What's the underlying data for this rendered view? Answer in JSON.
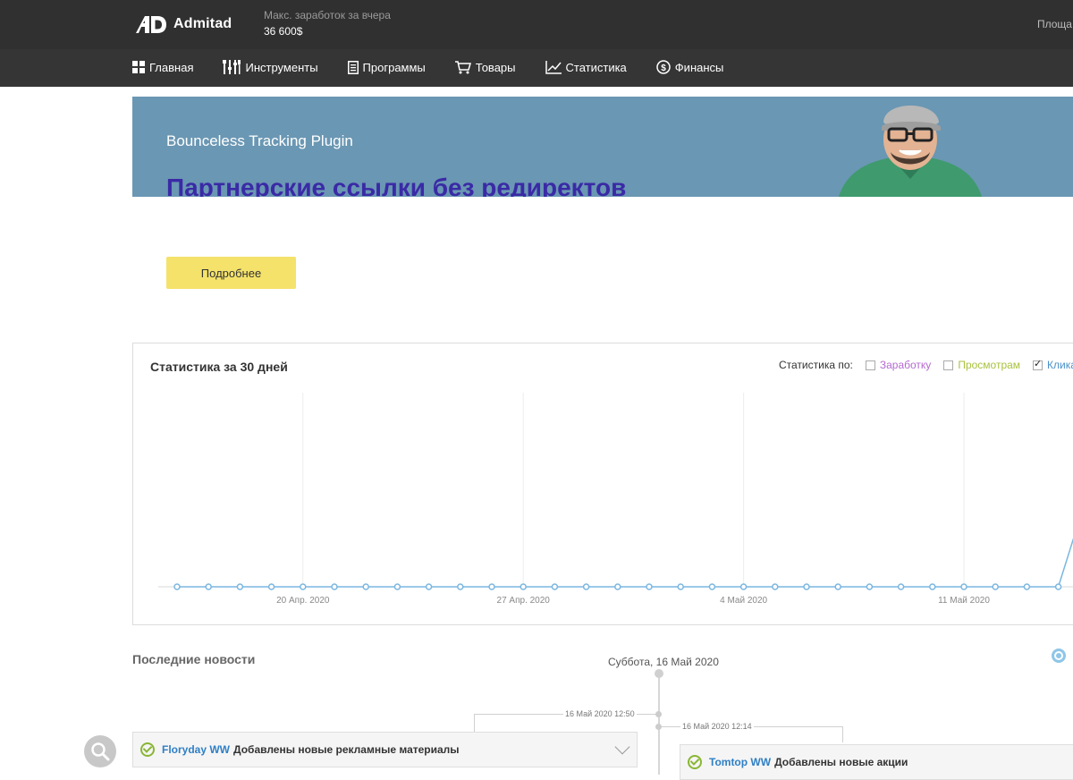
{
  "header": {
    "logo_text": "Admitad",
    "earnings_label": "Макс. заработок за вчера",
    "earnings_value": "36 600$",
    "platform_label": "Площа",
    "nav": [
      {
        "label": "Главная",
        "icon": "grid-icon"
      },
      {
        "label": "Инструменты",
        "icon": "tools-icon"
      },
      {
        "label": "Программы",
        "icon": "document-icon"
      },
      {
        "label": "Товары",
        "icon": "cart-icon"
      },
      {
        "label": "Статистика",
        "icon": "chart-icon"
      },
      {
        "label": "Финансы",
        "icon": "dollar-icon"
      }
    ]
  },
  "banner": {
    "subtitle": "Bounceless Tracking Plugin",
    "title": "Партнерские ссылки без редиректов",
    "button_label": "Подробнее"
  },
  "stats": {
    "title": "Статистика за 30 дней",
    "by_label": "Статистика по:",
    "options": [
      {
        "label": "Заработку",
        "checked": false,
        "color": "#b56ad0"
      },
      {
        "label": "Просмотрам",
        "checked": false,
        "color": "#a9c23f"
      },
      {
        "label": "Клика",
        "checked": true,
        "color": "#4a90c8"
      }
    ]
  },
  "chart_data": {
    "type": "line",
    "series": [
      {
        "name": "Клики",
        "values": [
          0,
          0,
          0,
          0,
          0,
          0,
          0,
          0,
          0,
          0,
          0,
          0,
          0,
          0,
          0,
          0,
          0,
          0,
          0,
          0,
          0,
          0,
          0,
          0,
          0,
          0,
          0,
          0,
          0,
          1
        ]
      }
    ],
    "x_tick_labels": [
      "20 Апр. 2020",
      "27 Апр. 2020",
      "4 Май 2020",
      "11 Май 2020"
    ],
    "color": "#7ab6e0",
    "grid": "vertical"
  },
  "news": {
    "title": "Последние новости",
    "date": "Суббота, 16 Май 2020",
    "items": [
      {
        "time": "16 Май 2020 12:50",
        "program": "Floryday WW",
        "text": "Добавлены новые рекламные материалы"
      },
      {
        "time": "16 Май 2020 12:14",
        "program": "Tomtop WW",
        "text": "Добавлены новые акции"
      }
    ]
  }
}
